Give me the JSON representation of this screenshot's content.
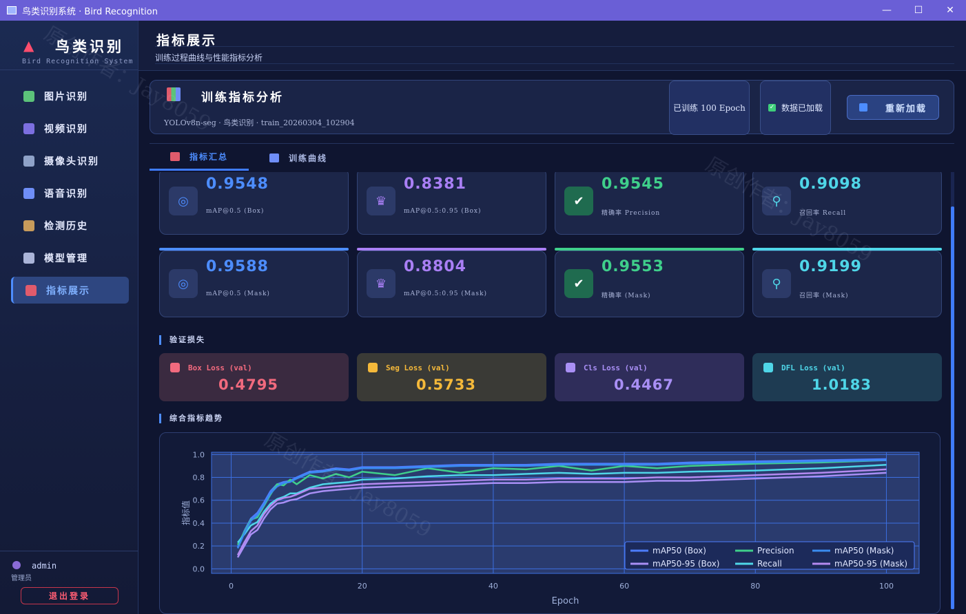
{
  "window": {
    "title": "鸟类识别系统 · Bird Recognition",
    "minimize": "—",
    "maximize": "☐",
    "close": "✕"
  },
  "sidebar": {
    "app_name": "鸟类识别",
    "app_sub": "Bird Recognition System",
    "items": [
      {
        "label": "图片识别",
        "icon": "image-icon",
        "color": "#5cc27a"
      },
      {
        "label": "视频识别",
        "icon": "clapper-icon",
        "color": "#7c6fe0"
      },
      {
        "label": "摄像头识别",
        "icon": "camera-icon",
        "color": "#8fa2c8"
      },
      {
        "label": "语音识别",
        "icon": "speaker-icon",
        "color": "#6f8ef7"
      },
      {
        "label": "检测历史",
        "icon": "clipboard-icon",
        "color": "#c79b5b"
      },
      {
        "label": "模型管理",
        "icon": "gear-icon",
        "color": "#aab4d8"
      },
      {
        "label": "指标展示",
        "icon": "bar-chart-icon",
        "color": "#e05b6c",
        "active": true
      }
    ],
    "user": {
      "name": "admin",
      "role": "管理员"
    },
    "logout_label": "退出登录"
  },
  "header": {
    "title": "指标展示",
    "subtitle": "训练过程曲线与性能指标分析"
  },
  "panel": {
    "title": "训练指标分析",
    "meta": "YOLOv8n-seg  ·  鸟类识别  ·  train_20260304_102904",
    "epoch_badge": "已训练 100 Epoch",
    "loaded_badge": "数据已加载",
    "reload_label": "重新加载"
  },
  "tabs": [
    {
      "label": "指标汇总",
      "active": true
    },
    {
      "label": "训练曲线",
      "active": false
    }
  ],
  "metrics": [
    {
      "value": "0.9548",
      "label": "mAP@0.5 (Box)",
      "color": "#4d8dff",
      "icon": "target-icon"
    },
    {
      "value": "0.8381",
      "label": "mAP@0.5:0.95 (Box)",
      "color": "#a97ff5",
      "icon": "trophy-icon"
    },
    {
      "value": "0.9545",
      "label": "精确率 Precision",
      "color": "#3fcf8b",
      "icon": "check-icon"
    },
    {
      "value": "0.9098",
      "label": "召回率 Recall",
      "color": "#4fd6e8",
      "icon": "magnifier-icon"
    },
    {
      "value": "0.9588",
      "label": "mAP@0.5 (Mask)",
      "color": "#4d8dff",
      "icon": "target-icon"
    },
    {
      "value": "0.8804",
      "label": "mAP@0.5:0.95 (Mask)",
      "color": "#a97ff5",
      "icon": "trophy-icon"
    },
    {
      "value": "0.9553",
      "label": "精确率 (Mask)",
      "color": "#3fcf8b",
      "icon": "check-icon"
    },
    {
      "value": "0.9199",
      "label": "召回率 (Mask)",
      "color": "#4fd6e8",
      "icon": "magnifier-icon"
    }
  ],
  "losses_title": "验证损失",
  "losses": [
    {
      "label": "Box Loss (val)",
      "value": "0.4795",
      "bg": "#3a2a40",
      "fg": "#f26a7e",
      "icon": "box-icon"
    },
    {
      "label": "Seg Loss (val)",
      "value": "0.5733",
      "bg": "#3a3a36",
      "fg": "#f5b93a",
      "icon": "mask-icon"
    },
    {
      "label": "Cls Loss (val)",
      "value": "0.4467",
      "bg": "#2f2d5a",
      "fg": "#a98ff5",
      "icon": "tag-icon"
    },
    {
      "label": "DFL Loss (val)",
      "value": "1.0183",
      "bg": "#1e3b52",
      "fg": "#4fd6e8",
      "icon": "ruler-icon"
    }
  ],
  "trend_title": "综合指标趋势",
  "watermark": "原创作者：Jay8059",
  "chart_data": {
    "type": "line",
    "xlabel": "Epoch",
    "ylabel": "指标值",
    "xlim": [
      -3,
      105
    ],
    "ylim": [
      -0.04,
      1.02
    ],
    "xticks": [
      0,
      20,
      40,
      60,
      80,
      100
    ],
    "yticks": [
      0.0,
      0.2,
      0.4,
      0.6,
      0.8,
      1.0
    ],
    "grid": true,
    "legend": "bottom-right",
    "series": [
      {
        "name": "mAP50 (Box)",
        "color": "#4d7dff",
        "x": [
          1,
          2,
          3,
          4,
          5,
          6,
          7,
          8,
          9,
          10,
          12,
          14,
          16,
          18,
          20,
          25,
          30,
          35,
          40,
          45,
          50,
          55,
          60,
          65,
          70,
          80,
          90,
          100
        ],
        "values": [
          0.19,
          0.33,
          0.44,
          0.49,
          0.58,
          0.68,
          0.74,
          0.76,
          0.77,
          0.8,
          0.85,
          0.86,
          0.88,
          0.87,
          0.89,
          0.89,
          0.9,
          0.91,
          0.91,
          0.91,
          0.92,
          0.92,
          0.92,
          0.92,
          0.93,
          0.94,
          0.95,
          0.96
        ]
      },
      {
        "name": "mAP50-95 (Box)",
        "color": "#a98ff5",
        "x": [
          1,
          2,
          3,
          4,
          5,
          6,
          7,
          8,
          9,
          10,
          12,
          14,
          16,
          18,
          20,
          25,
          30,
          35,
          40,
          45,
          50,
          55,
          60,
          65,
          70,
          80,
          90,
          100
        ],
        "values": [
          0.1,
          0.2,
          0.3,
          0.34,
          0.44,
          0.52,
          0.57,
          0.58,
          0.6,
          0.61,
          0.66,
          0.68,
          0.69,
          0.7,
          0.71,
          0.72,
          0.73,
          0.74,
          0.75,
          0.75,
          0.76,
          0.76,
          0.76,
          0.77,
          0.77,
          0.79,
          0.81,
          0.84
        ]
      },
      {
        "name": "Precision",
        "color": "#3fcf8b",
        "x": [
          1,
          2,
          3,
          4,
          5,
          6,
          7,
          8,
          9,
          10,
          12,
          14,
          16,
          18,
          20,
          25,
          30,
          35,
          40,
          45,
          50,
          55,
          60,
          65,
          70,
          80,
          90,
          100
        ],
        "values": [
          0.21,
          0.32,
          0.43,
          0.45,
          0.55,
          0.65,
          0.74,
          0.73,
          0.78,
          0.74,
          0.82,
          0.79,
          0.83,
          0.8,
          0.85,
          0.82,
          0.88,
          0.84,
          0.88,
          0.87,
          0.9,
          0.86,
          0.9,
          0.88,
          0.9,
          0.92,
          0.93,
          0.95
        ]
      },
      {
        "name": "Recall",
        "color": "#4fd6e8",
        "x": [
          1,
          2,
          3,
          4,
          5,
          6,
          7,
          8,
          9,
          10,
          12,
          14,
          16,
          18,
          20,
          25,
          30,
          35,
          40,
          45,
          50,
          55,
          60,
          65,
          70,
          80,
          90,
          100
        ],
        "values": [
          0.23,
          0.3,
          0.38,
          0.41,
          0.5,
          0.57,
          0.61,
          0.63,
          0.66,
          0.66,
          0.71,
          0.74,
          0.75,
          0.76,
          0.78,
          0.79,
          0.81,
          0.82,
          0.82,
          0.83,
          0.84,
          0.83,
          0.84,
          0.84,
          0.85,
          0.86,
          0.88,
          0.91
        ]
      },
      {
        "name": "mAP50 (Mask)",
        "color": "#3a8cf0",
        "x": [
          1,
          2,
          3,
          4,
          5,
          6,
          7,
          8,
          9,
          10,
          12,
          14,
          16,
          18,
          20,
          25,
          30,
          35,
          40,
          45,
          50,
          55,
          60,
          65,
          70,
          80,
          90,
          100
        ],
        "values": [
          0.18,
          0.31,
          0.42,
          0.47,
          0.56,
          0.66,
          0.72,
          0.75,
          0.76,
          0.79,
          0.84,
          0.85,
          0.87,
          0.86,
          0.88,
          0.88,
          0.89,
          0.9,
          0.9,
          0.9,
          0.91,
          0.91,
          0.91,
          0.91,
          0.92,
          0.93,
          0.94,
          0.95
        ]
      },
      {
        "name": "mAP50-95 (Mask)",
        "color": "#b48af0",
        "x": [
          1,
          2,
          3,
          4,
          5,
          6,
          7,
          8,
          9,
          10,
          12,
          14,
          16,
          18,
          20,
          25,
          30,
          35,
          40,
          45,
          50,
          55,
          60,
          65,
          70,
          80,
          90,
          100
        ],
        "values": [
          0.12,
          0.23,
          0.33,
          0.38,
          0.48,
          0.55,
          0.6,
          0.62,
          0.63,
          0.65,
          0.7,
          0.71,
          0.72,
          0.73,
          0.74,
          0.75,
          0.76,
          0.77,
          0.78,
          0.78,
          0.79,
          0.79,
          0.79,
          0.8,
          0.8,
          0.82,
          0.84,
          0.87
        ]
      }
    ]
  }
}
